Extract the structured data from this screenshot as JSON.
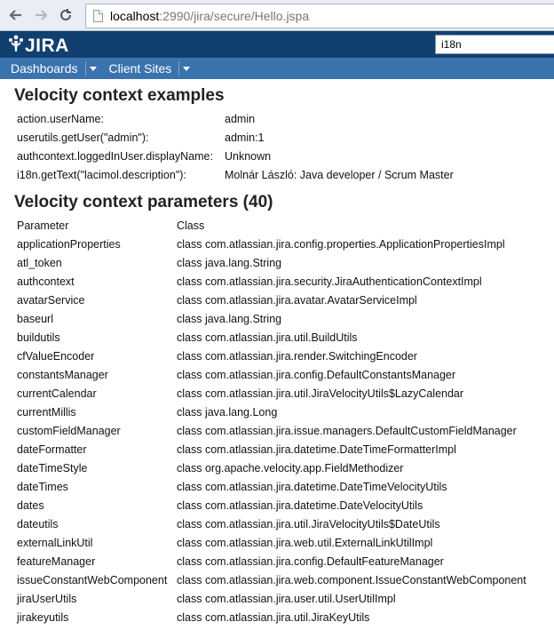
{
  "browser": {
    "url_host": "localhost",
    "url_rest": ":2990/jira/secure/Hello.jspa"
  },
  "header": {
    "logo_text": "JIRA",
    "search_value": "i18n"
  },
  "nav": [
    {
      "label": "Dashboards"
    },
    {
      "label": "Client Sites"
    }
  ],
  "section1": {
    "title": "Velocity context examples",
    "rows": [
      {
        "key": "action.userName:",
        "value": "admin"
      },
      {
        "key": "userutils.getUser(\"admin\"):",
        "value": "admin:1"
      },
      {
        "key": "authcontext.loggedInUser.displayName:",
        "value": "Unknown"
      },
      {
        "key": "i18n.getText(\"lacimol.description\"):",
        "value": "Molnár László: Java developer / Scrum Master"
      }
    ]
  },
  "section2": {
    "title": "Velocity context parameters (40)",
    "col_param": "Parameter",
    "col_class": "Class",
    "rows": [
      {
        "name": "applicationProperties",
        "cls": "class com.atlassian.jira.config.properties.ApplicationPropertiesImpl"
      },
      {
        "name": "atl_token",
        "cls": "class java.lang.String"
      },
      {
        "name": "authcontext",
        "cls": "class com.atlassian.jira.security.JiraAuthenticationContextImpl"
      },
      {
        "name": "avatarService",
        "cls": "class com.atlassian.jira.avatar.AvatarServiceImpl"
      },
      {
        "name": "baseurl",
        "cls": "class java.lang.String"
      },
      {
        "name": "buildutils",
        "cls": "class com.atlassian.jira.util.BuildUtils"
      },
      {
        "name": "cfValueEncoder",
        "cls": "class com.atlassian.jira.render.SwitchingEncoder"
      },
      {
        "name": "constantsManager",
        "cls": "class com.atlassian.jira.config.DefaultConstantsManager"
      },
      {
        "name": "currentCalendar",
        "cls": "class com.atlassian.jira.util.JiraVelocityUtils$LazyCalendar"
      },
      {
        "name": "currentMillis",
        "cls": "class java.lang.Long"
      },
      {
        "name": "customFieldManager",
        "cls": "class com.atlassian.jira.issue.managers.DefaultCustomFieldManager"
      },
      {
        "name": "dateFormatter",
        "cls": "class com.atlassian.jira.datetime.DateTimeFormatterImpl"
      },
      {
        "name": "dateTimeStyle",
        "cls": "class org.apache.velocity.app.FieldMethodizer"
      },
      {
        "name": "dateTimes",
        "cls": "class com.atlassian.jira.datetime.DateTimeVelocityUtils"
      },
      {
        "name": "dates",
        "cls": "class com.atlassian.jira.datetime.DateVelocityUtils"
      },
      {
        "name": "dateutils",
        "cls": "class com.atlassian.jira.util.JiraVelocityUtils$DateUtils"
      },
      {
        "name": "externalLinkUtil",
        "cls": "class com.atlassian.jira.web.util.ExternalLinkUtilImpl"
      },
      {
        "name": "featureManager",
        "cls": "class com.atlassian.jira.config.DefaultFeatureManager"
      },
      {
        "name": "issueConstantWebComponent",
        "cls": "class com.atlassian.jira.web.component.IssueConstantWebComponent"
      },
      {
        "name": "jiraUserUtils",
        "cls": "class com.atlassian.jira.user.util.UserUtilImpl"
      },
      {
        "name": "jirakeyutils",
        "cls": "class com.atlassian.jira.util.JiraKeyUtils"
      }
    ]
  },
  "icons": {
    "back": "back-arrow-icon",
    "forward": "forward-arrow-icon",
    "reload": "reload-icon",
    "page": "page-icon",
    "logo": "jira-logo-icon",
    "caret": "chevron-down-icon"
  },
  "colors": {
    "header_bg": "#114070",
    "nav_bg": "#3b73af"
  }
}
